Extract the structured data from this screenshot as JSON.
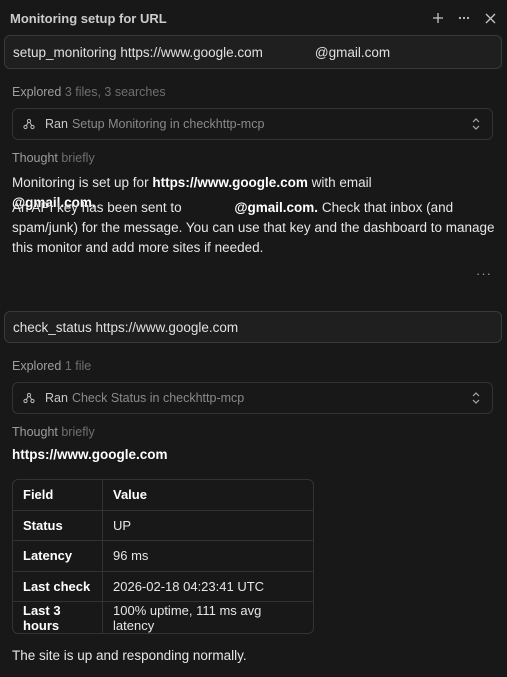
{
  "window": {
    "title": "Monitoring setup for URL"
  },
  "turn1": {
    "prompt_prefix": "setup_monitoring https://www.google.com",
    "prompt_suffix": "@gmail.com",
    "explored_label": "Explored",
    "explored_detail": "3 files, 3 searches",
    "tool": {
      "ran": "Ran",
      "name": "Setup Monitoring in checkhttp-mcp"
    },
    "thought_label": "Thought",
    "thought_detail": "briefly",
    "line1_a": "Monitoring is set up for ",
    "line1_url": "https://www.google.com",
    "line1_b": " with email ",
    "line1_email": "@gmail.com.",
    "line2_a": "An API key has been sent to ",
    "line2_email": "@gmail.com.",
    "line2_b": " Check that inbox (and spam/junk) for the message. You can use that key and the dashboard to manage this monitor and add more sites if needed.",
    "more": "···"
  },
  "turn2": {
    "prompt": "check_status https://www.google.com",
    "explored_label": "Explored",
    "explored_detail": "1 file",
    "tool": {
      "ran": "Ran",
      "name": "Check Status in checkhttp-mcp"
    },
    "thought_label": "Thought",
    "thought_detail": "briefly",
    "heading": "https://www.google.com",
    "table": {
      "headers": [
        "Field",
        "Value"
      ],
      "rows": [
        [
          "Status",
          "UP"
        ],
        [
          "Latency",
          "96 ms"
        ],
        [
          "Last check",
          "2026-02-18 04:23:41 UTC"
        ],
        [
          "Last 3 hours",
          "100% uptime, 111 ms avg latency"
        ]
      ]
    },
    "conclusion": "The site is up and responding normally."
  },
  "icons": [
    "plus-icon",
    "more-icon",
    "close-icon",
    "tool-icon",
    "chevron-updown-icon"
  ]
}
